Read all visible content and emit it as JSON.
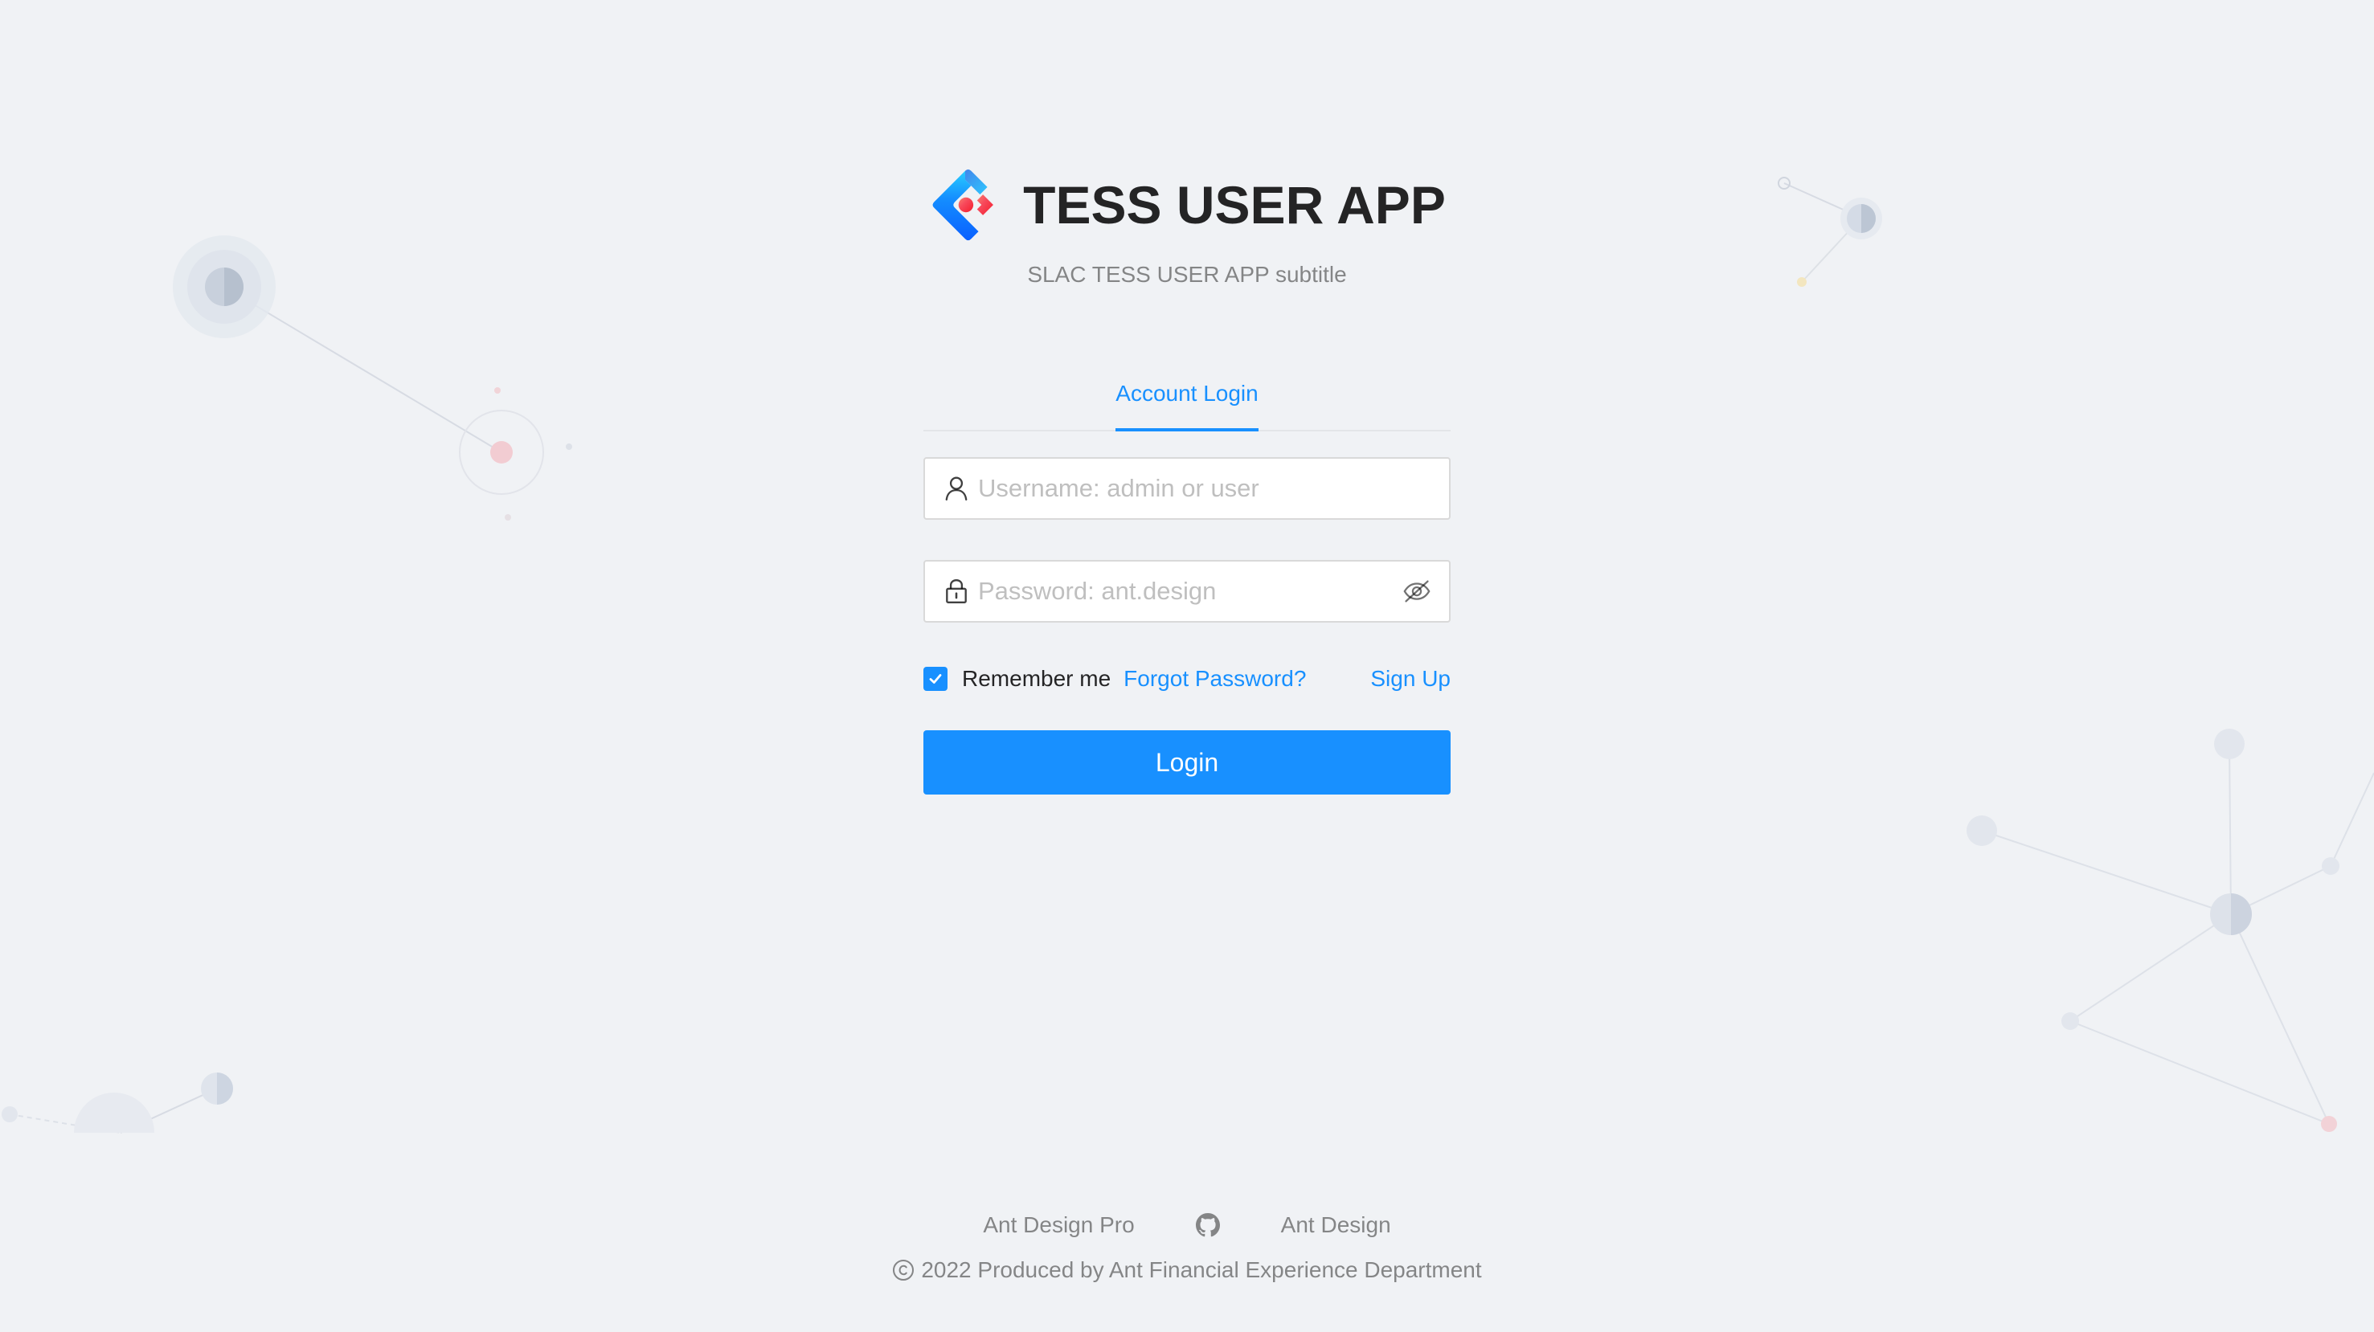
{
  "header": {
    "title": "TESS USER APP",
    "subtitle": "SLAC TESS USER APP subtitle",
    "logo_icon": "ant-design-logo-icon"
  },
  "tabs": {
    "active_label": "Account Login"
  },
  "form": {
    "username": {
      "placeholder": "Username: admin or user",
      "value": "",
      "icon": "user-icon"
    },
    "password": {
      "placeholder": "Password: ant.design",
      "value": "",
      "icon": "lock-icon",
      "toggle_icon": "eye-invisible-icon"
    },
    "remember_label": "Remember me",
    "remember_checked": true,
    "forgot_label": "Forgot Password?",
    "signup_label": "Sign Up",
    "submit_label": "Login"
  },
  "footer": {
    "links": [
      "Ant Design Pro",
      "Ant Design"
    ],
    "github_icon": "github-icon",
    "copyright": "2022 Produced by Ant Financial Experience Department"
  },
  "colors": {
    "primary": "#1890ff",
    "background": "#f0f2f5",
    "text_secondary": "rgba(0,0,0,0.45)"
  }
}
